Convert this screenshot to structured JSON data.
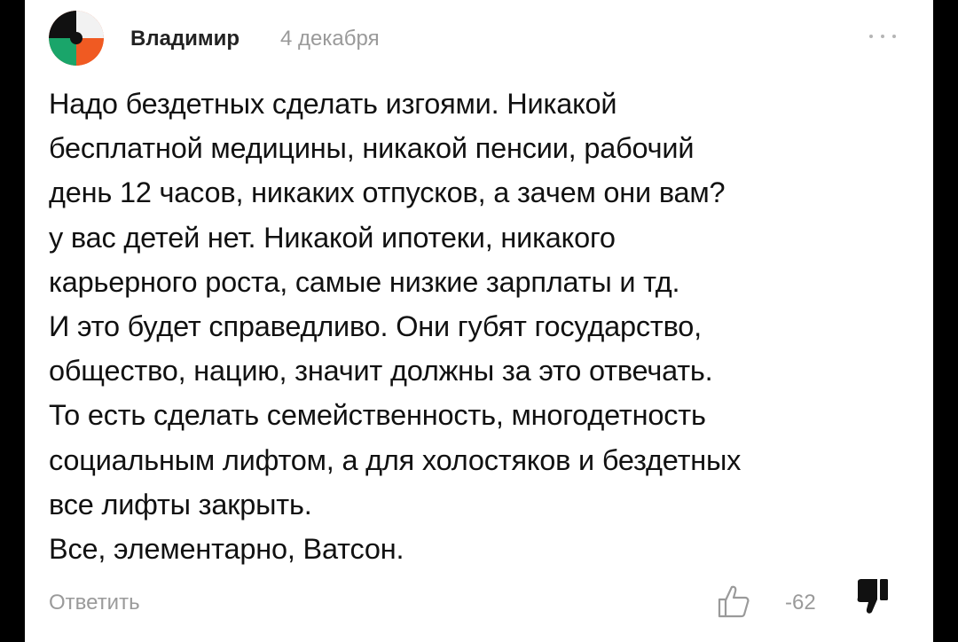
{
  "comment": {
    "author": "Владимир",
    "date": "4 декабря",
    "avatar_icon": "avatar-circle-icon",
    "more_icon": "more-dots-icon",
    "lines": [
      "Надо бездетных сделать изгоями. Никакой",
      "бесплатной медицины, никакой пенсии, рабочий",
      "день 12 часов, никаких отпусков, а зачем они вам?",
      "у вас детей нет. Никакой ипотеки, никакого",
      "карьерного роста, самые низкие зарплаты и тд.",
      "И это будет справедливо. Они губят государство,",
      "общество, нацию, значит должны за это отвечать.",
      "То есть сделать семейственность, многодетность",
      "социальным лифтом, а для холостяков и бездетных",
      "все лифты закрыть.",
      "Все, элементарно, Ватсон."
    ]
  },
  "footer": {
    "reply_label": "Ответить",
    "rating": "-62",
    "like_icon": "thumbs-up-outline-icon",
    "dislike_icon": "thumbs-down-filled-icon"
  },
  "colors": {
    "text": "#111111",
    "muted": "#9a9a9a",
    "avatar_green": "#1aa56a",
    "avatar_orange": "#f05a22",
    "avatar_black": "#111111",
    "avatar_light": "#f2f2f2"
  }
}
